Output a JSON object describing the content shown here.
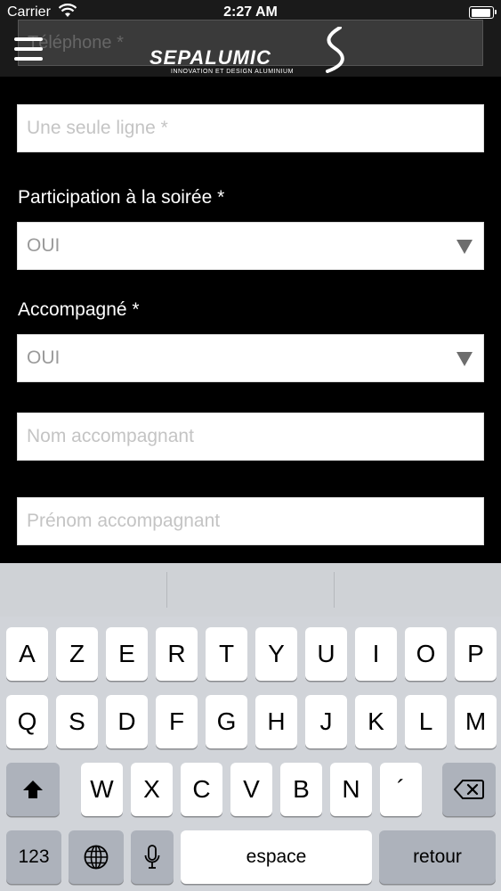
{
  "status_bar": {
    "carrier": "Carrier",
    "time": "2:27 AM"
  },
  "header": {
    "behind_field_placeholder": "Téléphone *",
    "logo_text": "SEPALUMIC",
    "logo_tagline": "INNOVATION ET DESIGN ALUMINIUM"
  },
  "form": {
    "single_line_placeholder": "Une seule ligne *",
    "participation_label": "Participation à la soirée *",
    "participation_value": "OUI",
    "accompagne_label": "Accompagné *",
    "accompagne_value": "OUI",
    "nom_placeholder": "Nom accompagnant",
    "prenom_placeholder": "Prénom accompagnant"
  },
  "keyboard": {
    "row1": [
      "A",
      "Z",
      "E",
      "R",
      "T",
      "Y",
      "U",
      "I",
      "O",
      "P"
    ],
    "row2": [
      "Q",
      "S",
      "D",
      "F",
      "G",
      "H",
      "J",
      "K",
      "L",
      "M"
    ],
    "row3": [
      "W",
      "X",
      "C",
      "V",
      "B",
      "N",
      "´"
    ],
    "numbers_key": "123",
    "space_key": "espace",
    "return_key": "retour"
  }
}
